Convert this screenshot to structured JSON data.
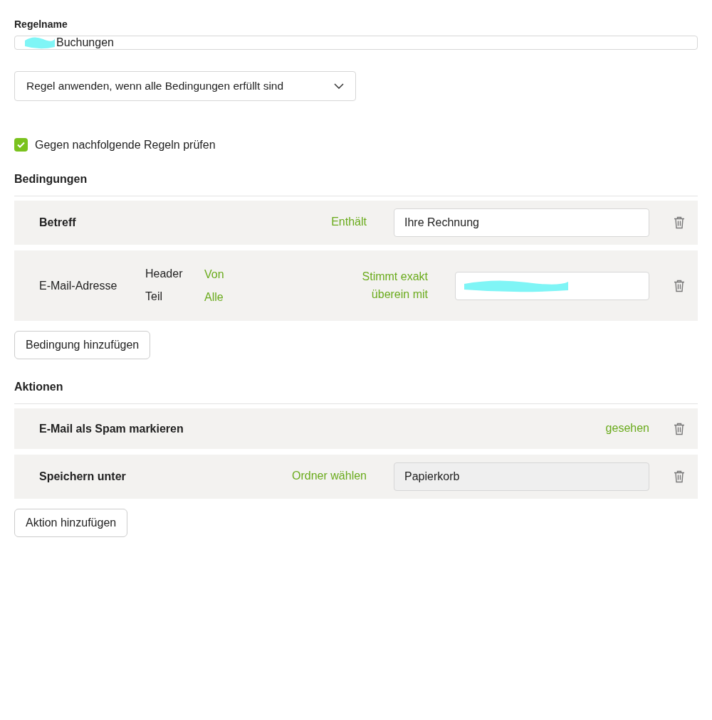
{
  "rule_name": {
    "label": "Regelname",
    "value": "Buchungen",
    "redacted": true
  },
  "match_mode": {
    "value": "Regel anwenden, wenn alle Bedingungen erfüllt sind"
  },
  "check_following": {
    "label": "Gegen nachfolgende Regeln prüfen",
    "checked": true
  },
  "conditions": {
    "title": "Bedingungen",
    "rows": [
      {
        "kind": "simple",
        "field": "Betreff",
        "operator": "Enthält",
        "value": "Ihre Rechnung"
      },
      {
        "kind": "header",
        "field": "E-Mail-Adresse",
        "options": [
          {
            "label": "Header",
            "value": "Von"
          },
          {
            "label": "Teil",
            "value": "Alle"
          }
        ],
        "operator_lines": [
          "Stimmt exakt",
          "überein mit"
        ],
        "redacted": true
      }
    ],
    "add_button": "Bedingung hinzufügen"
  },
  "actions": {
    "title": "Aktionen",
    "rows": [
      {
        "kind": "flag",
        "label": "E-Mail als Spam markieren",
        "option": "gesehen"
      },
      {
        "kind": "folder",
        "label": "Speichern unter",
        "option": "Ordner wählen",
        "value": "Papierkorb",
        "disabled": true
      }
    ],
    "add_button": "Aktion hinzufügen"
  }
}
